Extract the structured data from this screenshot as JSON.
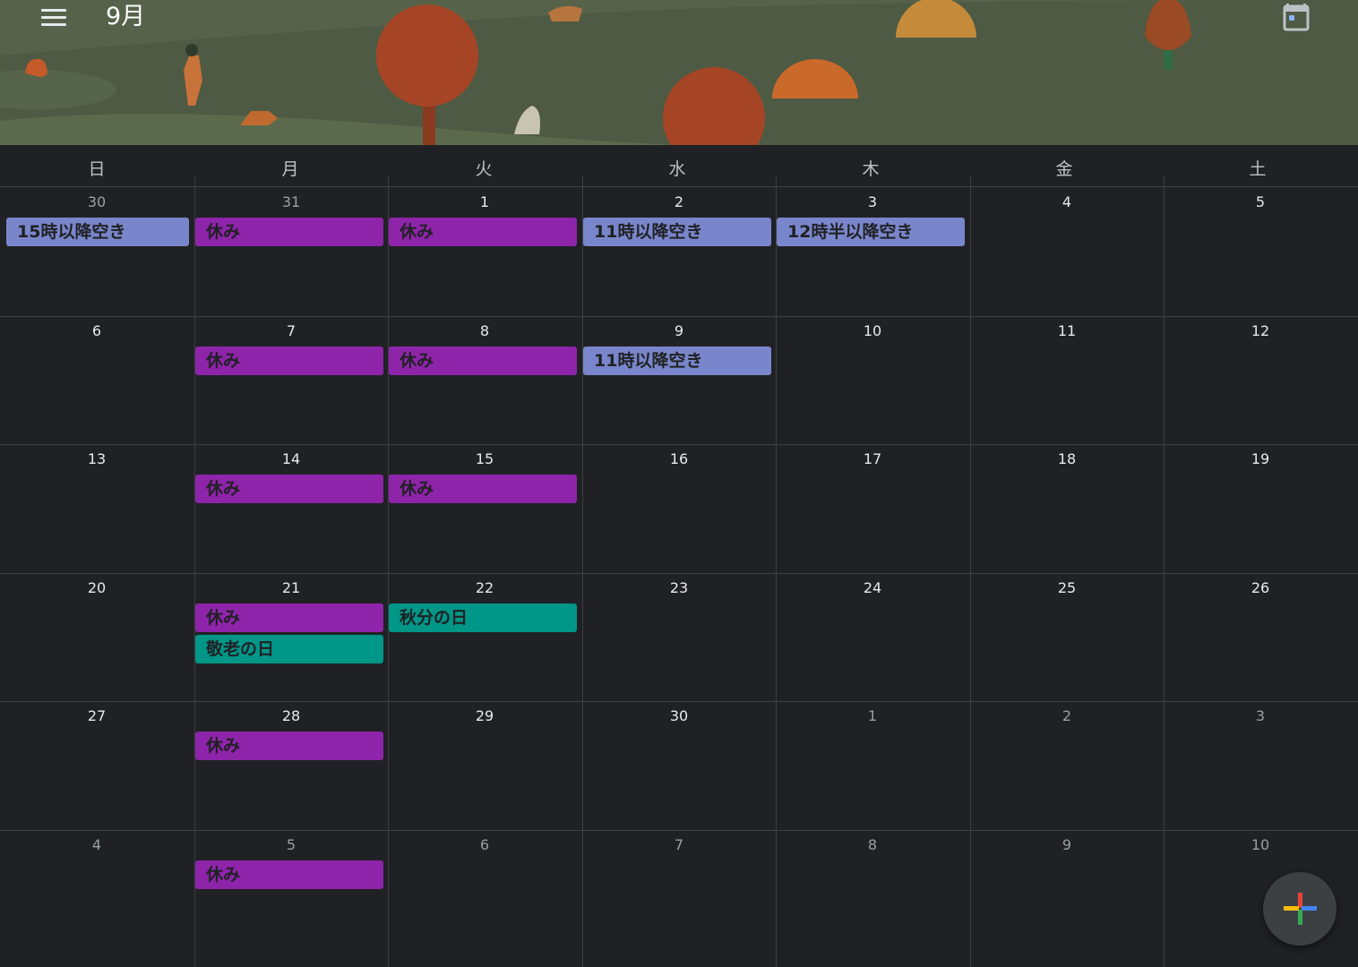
{
  "header": {
    "month_title": "9月",
    "menu_icon": "hamburger-menu-icon",
    "today_icon": "calendar-today-icon"
  },
  "weekdays": [
    "日",
    "月",
    "火",
    "水",
    "木",
    "金",
    "土"
  ],
  "weeks": [
    [
      {
        "day": "30",
        "current_month": false,
        "events": [
          {
            "title": "15時以降空き",
            "color": "blue"
          }
        ]
      },
      {
        "day": "31",
        "current_month": false,
        "events": [
          {
            "title": "休み",
            "color": "purple"
          }
        ]
      },
      {
        "day": "1",
        "current_month": true,
        "events": [
          {
            "title": "休み",
            "color": "purple"
          }
        ]
      },
      {
        "day": "2",
        "current_month": true,
        "events": [
          {
            "title": "11時以降空き",
            "color": "blue"
          }
        ]
      },
      {
        "day": "3",
        "current_month": true,
        "events": [
          {
            "title": "12時半以降空き",
            "color": "blue"
          }
        ]
      },
      {
        "day": "4",
        "current_month": true,
        "events": []
      },
      {
        "day": "5",
        "current_month": true,
        "events": []
      }
    ],
    [
      {
        "day": "6",
        "current_month": true,
        "events": []
      },
      {
        "day": "7",
        "current_month": true,
        "events": [
          {
            "title": "休み",
            "color": "purple"
          }
        ]
      },
      {
        "day": "8",
        "current_month": true,
        "events": [
          {
            "title": "休み",
            "color": "purple"
          }
        ]
      },
      {
        "day": "9",
        "current_month": true,
        "events": [
          {
            "title": "11時以降空き",
            "color": "blue"
          }
        ]
      },
      {
        "day": "10",
        "current_month": true,
        "events": []
      },
      {
        "day": "11",
        "current_month": true,
        "events": []
      },
      {
        "day": "12",
        "current_month": true,
        "events": []
      }
    ],
    [
      {
        "day": "13",
        "current_month": true,
        "events": []
      },
      {
        "day": "14",
        "current_month": true,
        "events": [
          {
            "title": "休み",
            "color": "purple"
          }
        ]
      },
      {
        "day": "15",
        "current_month": true,
        "events": [
          {
            "title": "休み",
            "color": "purple"
          }
        ]
      },
      {
        "day": "16",
        "current_month": true,
        "events": []
      },
      {
        "day": "17",
        "current_month": true,
        "events": []
      },
      {
        "day": "18",
        "current_month": true,
        "events": []
      },
      {
        "day": "19",
        "current_month": true,
        "events": []
      }
    ],
    [
      {
        "day": "20",
        "current_month": true,
        "events": []
      },
      {
        "day": "21",
        "current_month": true,
        "events": [
          {
            "title": "休み",
            "color": "purple"
          },
          {
            "title": "敬老の日",
            "color": "teal"
          }
        ]
      },
      {
        "day": "22",
        "current_month": true,
        "events": [
          {
            "title": "秋分の日",
            "color": "teal"
          }
        ]
      },
      {
        "day": "23",
        "current_month": true,
        "events": []
      },
      {
        "day": "24",
        "current_month": true,
        "events": []
      },
      {
        "day": "25",
        "current_month": true,
        "events": []
      },
      {
        "day": "26",
        "current_month": true,
        "events": []
      }
    ],
    [
      {
        "day": "27",
        "current_month": true,
        "events": []
      },
      {
        "day": "28",
        "current_month": true,
        "events": [
          {
            "title": "休み",
            "color": "purple"
          }
        ]
      },
      {
        "day": "29",
        "current_month": true,
        "events": []
      },
      {
        "day": "30",
        "current_month": true,
        "events": []
      },
      {
        "day": "1",
        "current_month": false,
        "events": []
      },
      {
        "day": "2",
        "current_month": false,
        "events": []
      },
      {
        "day": "3",
        "current_month": false,
        "events": []
      }
    ],
    [
      {
        "day": "4",
        "current_month": false,
        "events": []
      },
      {
        "day": "5",
        "current_month": false,
        "events": [
          {
            "title": "休み",
            "color": "purple"
          }
        ]
      },
      {
        "day": "6",
        "current_month": false,
        "events": []
      },
      {
        "day": "7",
        "current_month": false,
        "events": []
      },
      {
        "day": "8",
        "current_month": false,
        "events": []
      },
      {
        "day": "9",
        "current_month": false,
        "events": []
      },
      {
        "day": "10",
        "current_month": false,
        "events": []
      }
    ]
  ],
  "colors": {
    "background": "#202124",
    "blue": "#7986cb",
    "purple": "#8e24aa",
    "teal": "#009688",
    "banner": "#4e5a43"
  },
  "fab": {
    "icon": "create-plus-icon"
  }
}
